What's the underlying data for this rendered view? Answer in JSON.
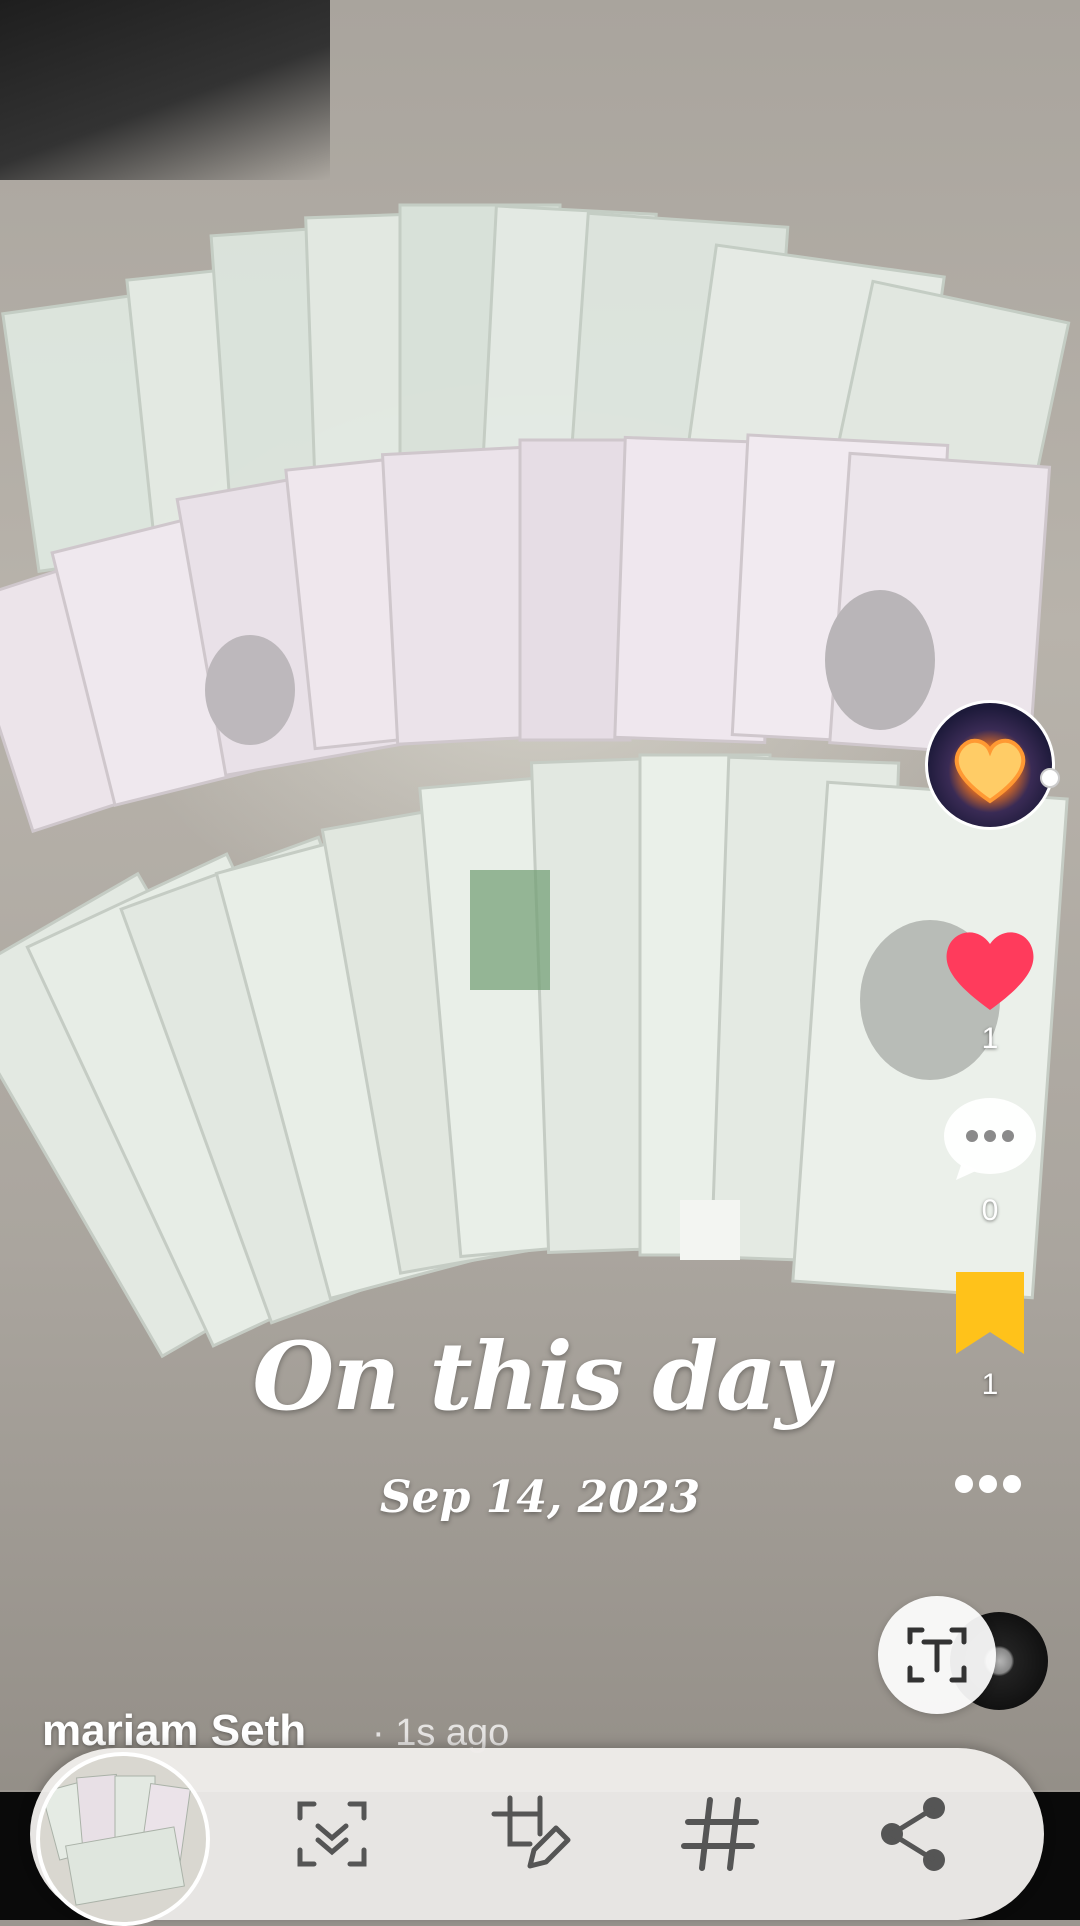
{
  "post": {
    "caption_title": "On this day",
    "caption_date": "Sep 14, 2023",
    "username": "mariam Seth",
    "time_ago": " · 1s ago"
  },
  "actions": {
    "like_count": "1",
    "comment_count": "0",
    "save_count": "1"
  },
  "bottom_bar": {
    "buttons": [
      "scan-icon",
      "crop-edit-icon",
      "hashtag-icon",
      "share-icon"
    ]
  },
  "colors": {
    "like": "#ff3b5c",
    "save": "#ffc21a",
    "bar_bg": "#eeecea"
  }
}
